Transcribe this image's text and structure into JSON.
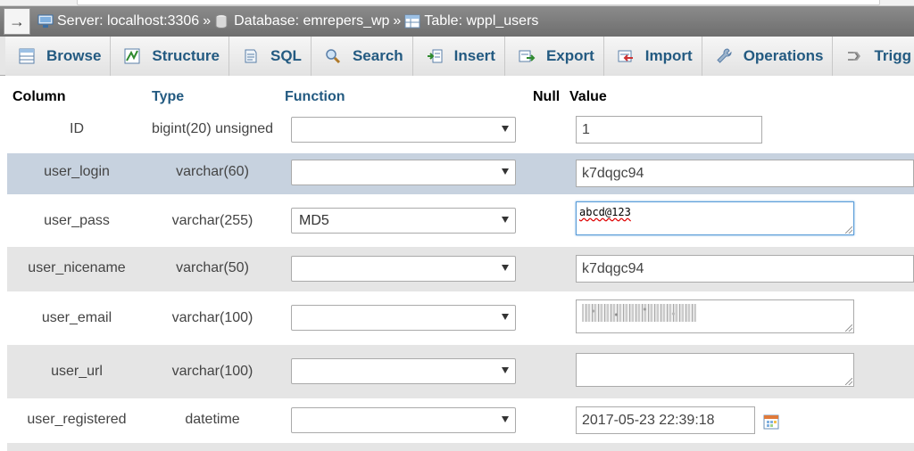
{
  "breadcrumb": {
    "server": "Server: localhost:3306",
    "database": "Database: emrepers_wp",
    "table": "Table: wppl_users",
    "separator": "»"
  },
  "tabs": [
    {
      "label": "Browse",
      "icon": "browse-icon"
    },
    {
      "label": "Structure",
      "icon": "structure-icon"
    },
    {
      "label": "SQL",
      "icon": "sql-icon"
    },
    {
      "label": "Search",
      "icon": "search-icon"
    },
    {
      "label": "Insert",
      "icon": "insert-icon"
    },
    {
      "label": "Export",
      "icon": "export-icon"
    },
    {
      "label": "Import",
      "icon": "import-icon"
    },
    {
      "label": "Operations",
      "icon": "wrench-icon"
    },
    {
      "label": "Trigg",
      "icon": "triggers-icon"
    }
  ],
  "headers": {
    "column": "Column",
    "type": "Type",
    "function": "Function",
    "null": "Null",
    "value": "Value"
  },
  "rows": [
    {
      "name": "ID",
      "type": "bigint(20) unsigned",
      "function": "",
      "value": "1"
    },
    {
      "name": "user_login",
      "type": "varchar(60)",
      "function": "",
      "value": "k7dqgc94"
    },
    {
      "name": "user_pass",
      "type": "varchar(255)",
      "function": "MD5",
      "value": "abcd@123"
    },
    {
      "name": "user_nicename",
      "type": "varchar(50)",
      "function": "",
      "value": "k7dqgc94"
    },
    {
      "name": "user_email",
      "type": "varchar(100)",
      "function": "",
      "value": ""
    },
    {
      "name": "user_url",
      "type": "varchar(100)",
      "function": "",
      "value": ""
    },
    {
      "name": "user_registered",
      "type": "datetime",
      "function": "",
      "value": "2017-05-23 22:39:18"
    }
  ],
  "colors": {
    "link": "#235a81",
    "selected_row": "#c7d2df",
    "alt_row": "#e5e5e5",
    "breadcrumb_bg": "#7c7c7c"
  }
}
